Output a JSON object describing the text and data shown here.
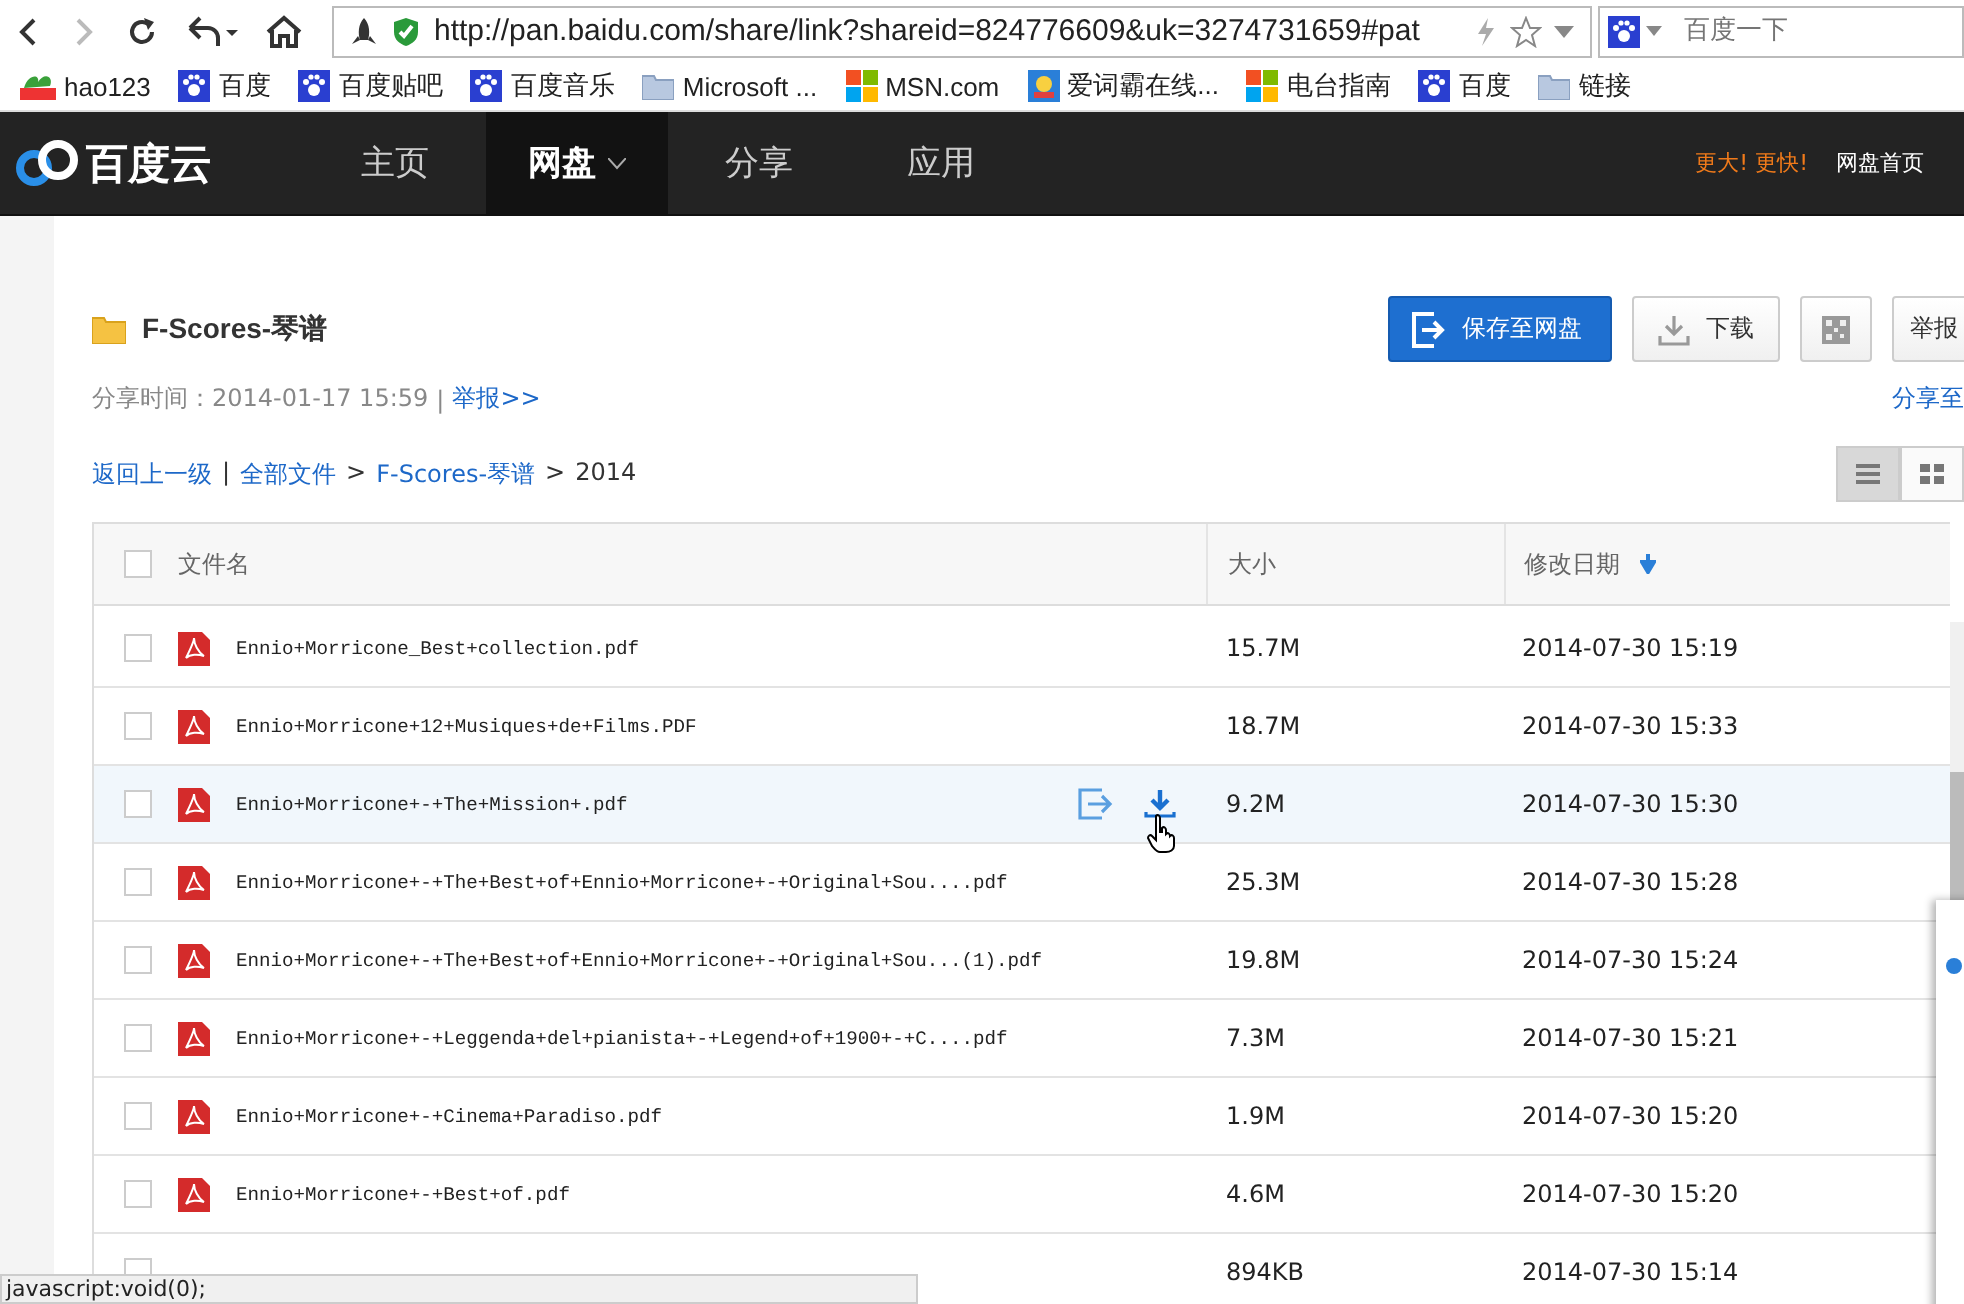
{
  "browser": {
    "url": "http://pan.baidu.com/share/link?shareid=824776609&uk=3274731659#pat",
    "search_placeholder": "百度一下",
    "bookmarks": [
      {
        "kind": "hao",
        "label": "hao123"
      },
      {
        "kind": "paw",
        "label": "百度"
      },
      {
        "kind": "paw",
        "label": "百度贴吧"
      },
      {
        "kind": "paw",
        "label": "百度音乐"
      },
      {
        "kind": "folder",
        "label": "Microsoft ..."
      },
      {
        "kind": "windows",
        "label": "MSN.com"
      },
      {
        "kind": "dict",
        "label": "爱词霸在线..."
      },
      {
        "kind": "windows",
        "label": "电台指南"
      },
      {
        "kind": "paw",
        "label": "百度"
      },
      {
        "kind": "folder",
        "label": "链接"
      }
    ]
  },
  "nav": {
    "logo": "百度云",
    "tabs": [
      {
        "label": "主页",
        "selected": false,
        "caret": false
      },
      {
        "label": "网盘",
        "selected": true,
        "caret": true
      },
      {
        "label": "分享",
        "selected": false,
        "caret": false
      },
      {
        "label": "应用",
        "selected": false,
        "caret": false
      }
    ],
    "promo": "更大! 更快!",
    "home_link": "网盘首页"
  },
  "share": {
    "title": "F-Scores-琴谱",
    "buttons": [
      {
        "kind": "primary",
        "label": "保存至网盘"
      },
      {
        "kind": "download",
        "label": "下载"
      },
      {
        "kind": "qr"
      },
      {
        "kind": "plain",
        "label": "举报"
      }
    ],
    "share_time": "分享时间：2014-01-17 15:59",
    "meta_separator": "|",
    "report_link": "举报>>",
    "share_to": "分享至",
    "breadcrumb": [
      {
        "label": "返回上一级",
        "kind": "link"
      },
      {
        "label": "|",
        "kind": "sep"
      },
      {
        "label": "全部文件",
        "kind": "link"
      },
      {
        "label": ">",
        "kind": "sep"
      },
      {
        "label": "F-Scores-琴谱",
        "kind": "link"
      },
      {
        "label": ">",
        "kind": "sep"
      },
      {
        "label": "2014",
        "kind": "current"
      }
    ],
    "views": [
      {
        "kind": "list",
        "selected": true
      },
      {
        "kind": "grid",
        "selected": false
      }
    ]
  },
  "table": {
    "select_all_checked": false,
    "columns": [
      "文件名",
      "大小",
      "修改日期"
    ],
    "rows": [
      {
        "name": "Ennio+Morricone_Best+collection.pdf",
        "size": "15.7M",
        "date": "2014-07-30 15:19",
        "hovered": false,
        "checked": false
      },
      {
        "name": "Ennio+Morricone+12+Musiques+de+Films.PDF",
        "size": "18.7M",
        "date": "2014-07-30 15:33",
        "hovered": false,
        "checked": false
      },
      {
        "name": "Ennio+Morricone+-+The+Mission+.pdf",
        "size": "9.2M",
        "date": "2014-07-30 15:30",
        "hovered": true,
        "checked": false
      },
      {
        "name": "Ennio+Morricone+-+The+Best+of+Ennio+Morricone+-+Original+Sou....pdf",
        "size": "25.3M",
        "date": "2014-07-30 15:28",
        "hovered": false,
        "checked": false
      },
      {
        "name": "Ennio+Morricone+-+The+Best+of+Ennio+Morricone+-+Original+Sou...(1).pdf",
        "size": "19.8M",
        "date": "2014-07-30 15:24",
        "hovered": false,
        "checked": false
      },
      {
        "name": "Ennio+Morricone+-+Leggenda+del+pianista+-+Legend+of+1900+-+C....pdf",
        "size": "7.3M",
        "date": "2014-07-30 15:21",
        "hovered": false,
        "checked": false
      },
      {
        "name": "Ennio+Morricone+-+Cinema+Paradiso.pdf",
        "size": "1.9M",
        "date": "2014-07-30 15:20",
        "hovered": false,
        "checked": false
      },
      {
        "name": "Ennio+Morricone+-+Best+of.pdf",
        "size": "4.6M",
        "date": "2014-07-30 15:20",
        "hovered": false,
        "checked": false
      },
      {
        "size": "894KB",
        "date": "2014-07-30 15:14",
        "hovered": false
      }
    ]
  },
  "status_bar": "javascript:void(0);"
}
